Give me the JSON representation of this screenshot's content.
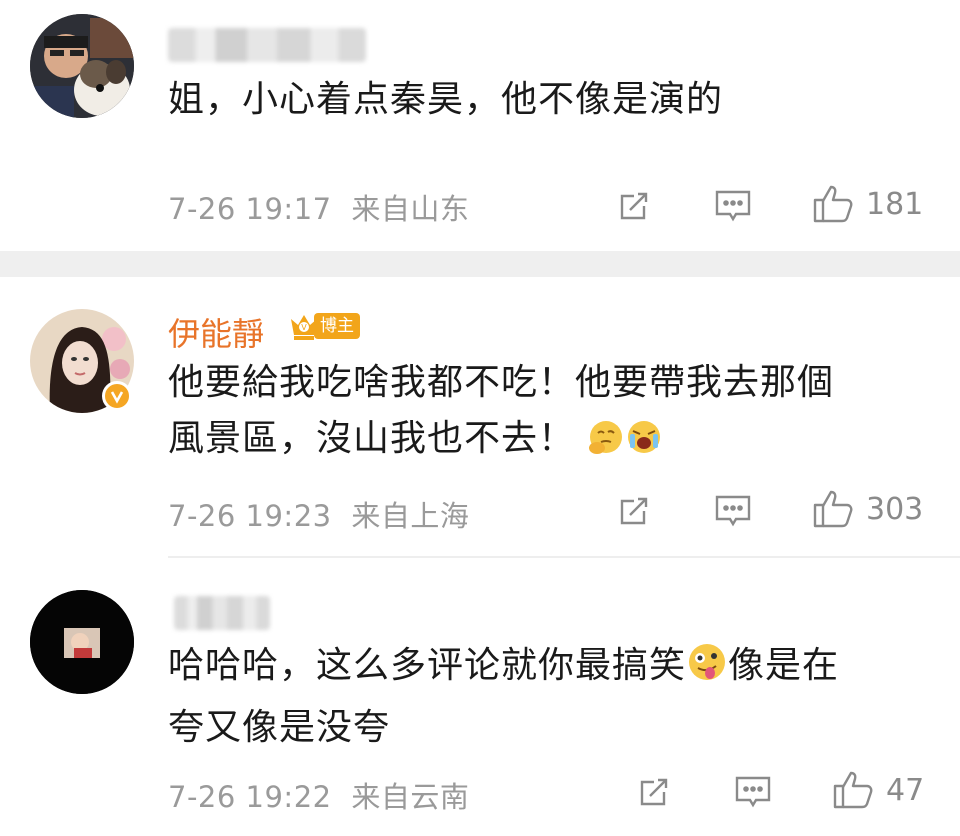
{
  "comments": [
    {
      "text_lines": [
        "姐，小心着点秦昊，他不像是演的"
      ],
      "time": "7-26 19:17",
      "location": "来自山东",
      "likes": "181"
    },
    {
      "username": "伊能靜",
      "badge": "博主",
      "text_lines": [
        "他要給我吃啥我都不吃！他要帶我去那個",
        "風景區，沒山我也不去！"
      ],
      "time": "7-26 19:23",
      "location": "来自上海",
      "likes": "303"
    },
    {
      "text_lines": [
        "哈哈哈，这么多评论就你最搞笑",
        "夸又像是没夸"
      ],
      "text_after_emoji": "像是在",
      "time": "7-26 19:22",
      "location": "来自云南",
      "likes": "47"
    }
  ],
  "colors": {
    "username": "#e8742a",
    "meta": "#9a9a9a",
    "badge": "#f2a51a",
    "band": "#efefef"
  },
  "icons": [
    "share-icon",
    "reply-icon",
    "like-icon",
    "crown-icon",
    "verified-icon",
    "emoji-thinking",
    "emoji-crying",
    "emoji-tongue"
  ]
}
